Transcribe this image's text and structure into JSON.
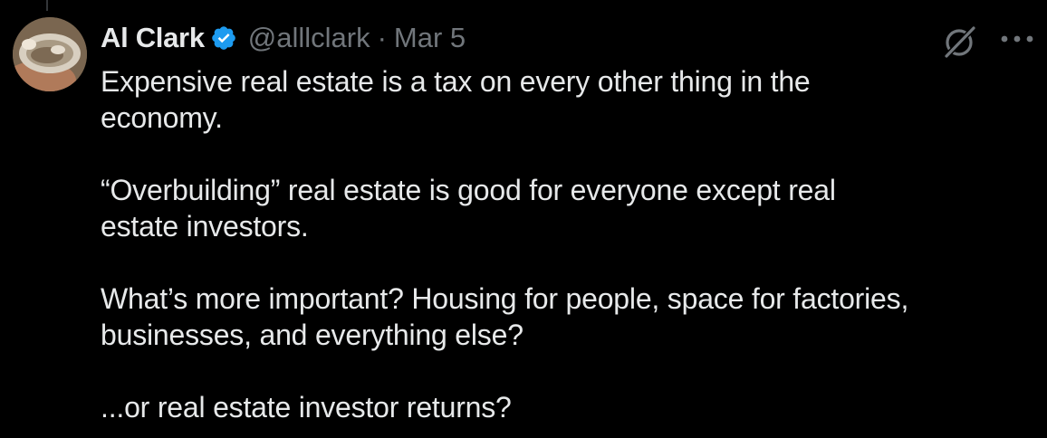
{
  "tweet": {
    "author": {
      "display_name": "Al Clark",
      "handle": "@alllclark",
      "verified": true,
      "verified_color": "#1d9bf0",
      "avatar_icon": "profile-photo"
    },
    "separator": "·",
    "date": "Mar 5",
    "paragraphs": [
      {
        "lines": [
          "Expensive real estate is a tax on every other thing in the",
          "economy."
        ]
      },
      {
        "lines": [
          "“Overbuilding” real estate is good for everyone except real",
          "estate investors."
        ]
      },
      {
        "lines": [
          "What’s more important? Housing for people, space for factories,",
          "businesses, and everything else?"
        ]
      },
      {
        "lines": [
          "...or real estate investor returns?"
        ]
      }
    ],
    "actions": {
      "grok_icon": "grok-icon",
      "more_icon": "more-icon"
    }
  },
  "colors": {
    "background": "#000000",
    "text_primary": "#e7e9ea",
    "text_secondary": "#71767b",
    "accent": "#1d9bf0"
  }
}
